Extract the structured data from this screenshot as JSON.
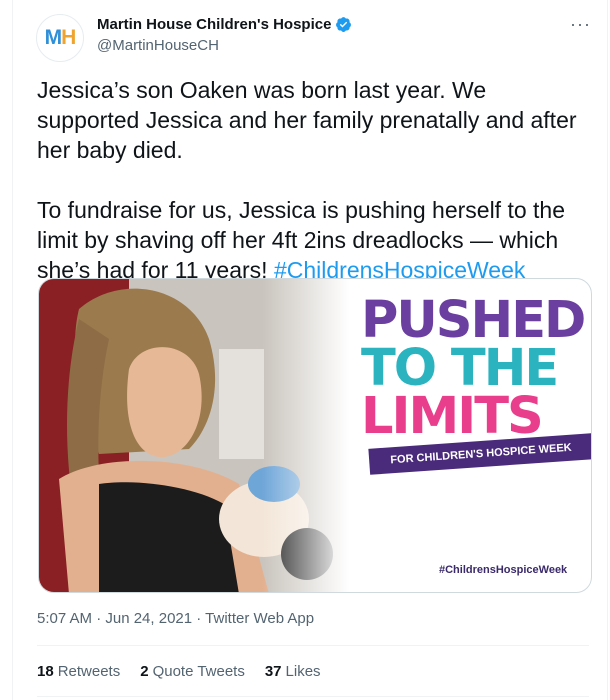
{
  "account": {
    "avatar_letters": [
      "M",
      "H"
    ],
    "display_name": "Martin House Children's Hospice",
    "handle": "@MartinHouseCH"
  },
  "more_glyph": "···",
  "tweet": {
    "paragraph1": "Jessica’s son Oaken was born last year. We supported Jessica and her family prenatally and after her baby died.",
    "paragraph2": "To fundraise for us, Jessica is pushing herself to the limit by shaving off her 4ft 2ins dreadlocks — which she’s had for 11 years! ",
    "hashtag": "#ChildrensHospiceWeek"
  },
  "image": {
    "title_lines": [
      "PUSHED",
      "TO THE",
      "LIMITS"
    ],
    "banner": "FOR CHILDREN'S HOSPICE WEEK",
    "hashtag": "#ChildrensHospiceWeek",
    "title_colors": [
      "#6b3fa0",
      "#e83e8c",
      "#2bb3c0",
      "#f39c12",
      "#8e44ad"
    ]
  },
  "meta": {
    "timestamp": "5:07 AM · Jun 24, 2021 · Twitter Web App"
  },
  "stats": {
    "retweets_count": "18",
    "retweets_label": "Retweets",
    "quotes_count": "2",
    "quotes_label": "Quote Tweets",
    "likes_count": "37",
    "likes_label": "Likes"
  },
  "colors": {
    "link": "#1d9bf0",
    "secondary_text": "#536471",
    "verified": "#1d9bf0"
  }
}
